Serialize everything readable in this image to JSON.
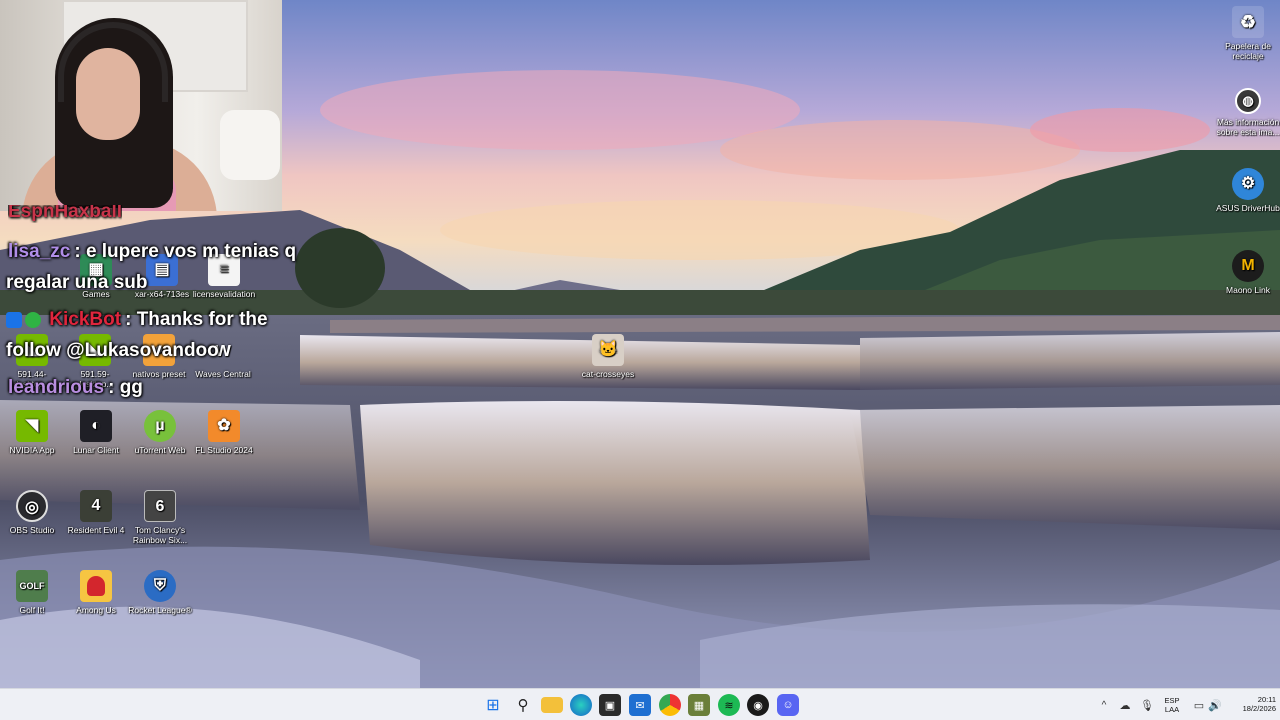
{
  "chat": {
    "partial_user": "EspnHaxball",
    "line1_user": "lisa_zc",
    "line1_sep": ":",
    "line1_msg_a": "e lupere vos m tenias q",
    "line1_msg_b": "regalar una sub",
    "line2_user": "KickBot",
    "line2_sep": ":",
    "line2_msg_a": "Thanks for the",
    "line2_msg_b": "follow @Lukasovandoo",
    "line3_user": "leandrious",
    "line3_sep": ":",
    "line3_msg": "gg"
  },
  "desktop_icons": {
    "games": "Games",
    "xmrig": "xar-x64-713es",
    "license": "licensevalidation",
    "desktop1": "591.44-desktop...",
    "desktop2": "591.59-desktop...",
    "nativos": "nativos preset",
    "waves": "Waves Central",
    "cat": "cat-crosseyes",
    "nvidia": "NVIDIA App",
    "lunar": "Lunar Client",
    "utorrent": "uTorrent Web",
    "fl": "FL Studio 2024",
    "obs": "OBS Studio",
    "re4": "Resident Evil 4",
    "rainbow_a": "Tom Clancy's",
    "rainbow_b": "Rainbow Six...",
    "golf": "Golf It!",
    "among": "Among Us",
    "rocket": "Rocket League®",
    "recycle_a": "Papelera de",
    "recycle_b": "reciclaje",
    "info_a": "Más información",
    "info_b": "sobre esta ima...",
    "asus": "ASUS DriverHub",
    "maono": "Maono Link"
  },
  "taskbar": {
    "lang_a": "ESP",
    "lang_b": "LAA",
    "time": "20:11",
    "date": "18/2/2026"
  }
}
